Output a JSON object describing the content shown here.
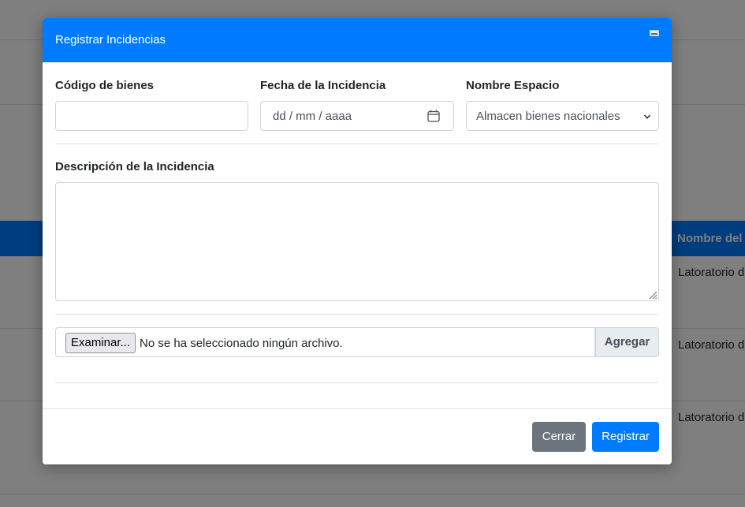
{
  "background": {
    "table_header": "Nombre del",
    "rows": [
      "Latoratorio d",
      "Latoratorio d",
      "Latoratorio d"
    ]
  },
  "modal": {
    "title": "Registrar Incidencias",
    "fields": {
      "codigo_label": "Código de bienes",
      "codigo_value": "",
      "fecha_label": "Fecha de la Incidencia",
      "fecha_placeholder": "dd / mm / aaaa",
      "espacio_label": "Nombre Espacio",
      "espacio_selected": "Almacen bienes nacionales",
      "descripcion_label": "Descripción de la Incidencia",
      "descripcion_value": ""
    },
    "file": {
      "browse_label": "Examinar...",
      "status": "No se ha seleccionado ningún archivo.",
      "add_label": "Agregar"
    },
    "footer": {
      "close_label": "Cerrar",
      "register_label": "Registrar"
    }
  },
  "colors": {
    "primary": "#007bff",
    "secondary": "#6c757d"
  },
  "icons": {
    "calendar": "calendar-icon",
    "select": "chevron-down-icon",
    "resize": "resize-grip-icon",
    "minimize": "minimize-icon"
  }
}
